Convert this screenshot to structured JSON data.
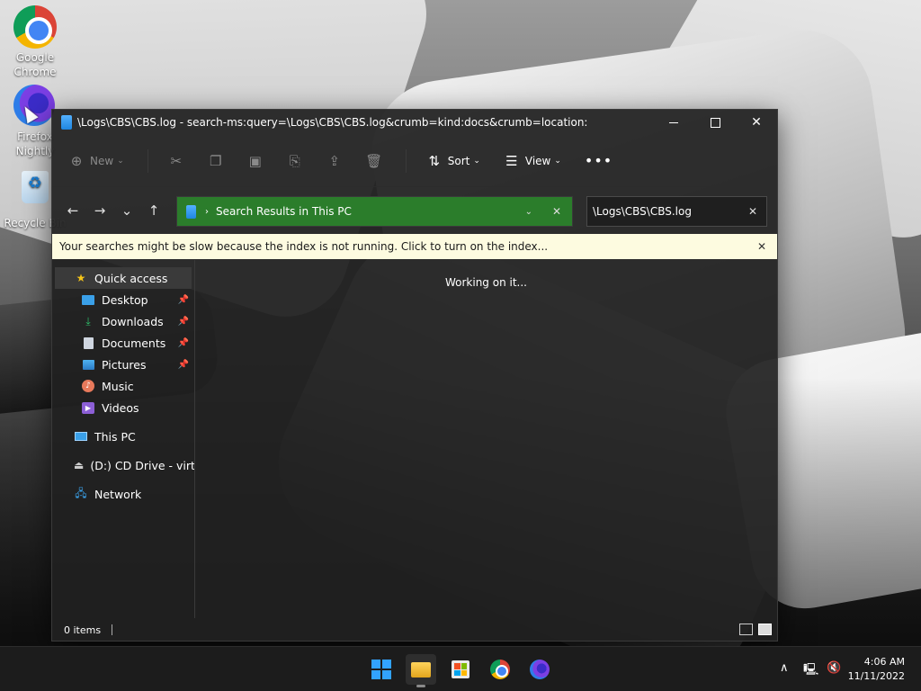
{
  "desktop": {
    "icons": [
      {
        "label": "Google Chrome"
      },
      {
        "label": "Firefox Nightly"
      },
      {
        "label": "Recycle Bin"
      }
    ]
  },
  "window": {
    "title": "\\Logs\\CBS\\CBS.log - search-ms:query=\\Logs\\CBS\\CBS.log&crumb=kind:docs&crumb=location:",
    "toolbar": {
      "new_label": "New",
      "sort_label": "Sort",
      "view_label": "View",
      "more_label": "•••"
    },
    "address": {
      "breadcrumb": "Search Results in This PC"
    },
    "search": {
      "value": "\\Logs\\CBS\\CBS.log"
    },
    "infobar": {
      "message": "Your searches might be slow because the index is not running.  Click to turn on the index..."
    },
    "nav_pane": {
      "quick_access": "Quick access",
      "items": [
        {
          "label": "Desktop",
          "pinned": true
        },
        {
          "label": "Downloads",
          "pinned": true
        },
        {
          "label": "Documents",
          "pinned": true
        },
        {
          "label": "Pictures",
          "pinned": true
        },
        {
          "label": "Music",
          "pinned": false
        },
        {
          "label": "Videos",
          "pinned": false
        }
      ],
      "this_pc": "This PC",
      "cd_drive": "(D:) CD Drive - virtio-win",
      "network": "Network"
    },
    "content": {
      "status_message": "Working on it..."
    },
    "statusbar": {
      "item_count": "0 items"
    }
  },
  "taskbar": {
    "clock_time": "4:06 AM",
    "clock_date": "11/11/2022"
  },
  "colors": {
    "address_bar_bg": "#2b7d2b",
    "infobar_bg": "#fdfbe0",
    "accent": "#32a3ff"
  }
}
